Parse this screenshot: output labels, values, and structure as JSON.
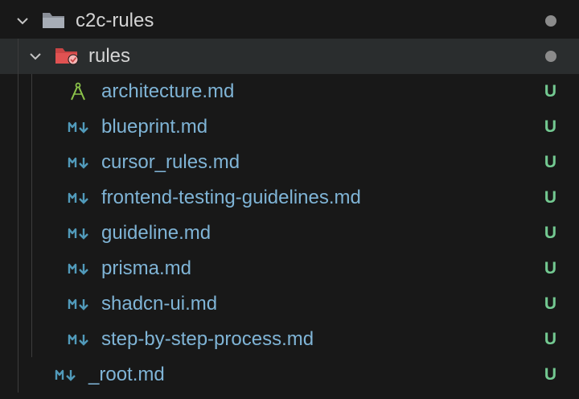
{
  "explorer": {
    "root_folder": {
      "name": "c2c-rules",
      "status": "modified-dot"
    },
    "sub_folder": {
      "name": "rules",
      "status": "modified-dot"
    },
    "files": [
      {
        "name": "architecture.md",
        "icon": "compass-icon",
        "status": "U"
      },
      {
        "name": "blueprint.md",
        "icon": "markdown-icon",
        "status": "U"
      },
      {
        "name": "cursor_rules.md",
        "icon": "markdown-icon",
        "status": "U"
      },
      {
        "name": "frontend-testing-guidelines.md",
        "icon": "markdown-icon",
        "status": "U"
      },
      {
        "name": "guideline.md",
        "icon": "markdown-icon",
        "status": "U"
      },
      {
        "name": "prisma.md",
        "icon": "markdown-icon",
        "status": "U"
      },
      {
        "name": "shadcn-ui.md",
        "icon": "markdown-icon",
        "status": "U"
      },
      {
        "name": "step-by-step-process.md",
        "icon": "markdown-icon",
        "status": "U"
      }
    ],
    "root_file": {
      "name": "_root.md",
      "icon": "markdown-icon",
      "status": "U"
    }
  },
  "colors": {
    "background": "#181818",
    "selected_row": "#2a2d2e",
    "untracked": "#73c991",
    "file_text": "#7fb4d6",
    "markdown_icon": "#519aba",
    "folder_red": "#e05252"
  }
}
